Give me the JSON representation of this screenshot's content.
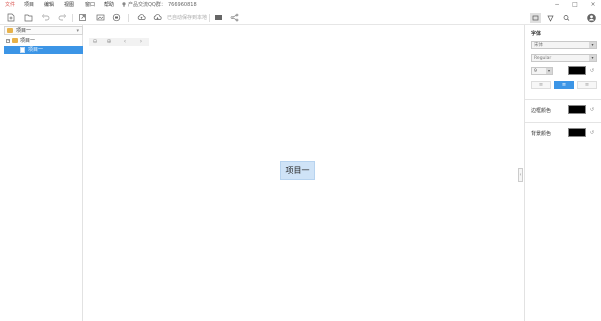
{
  "menubar": {
    "items": [
      {
        "label": "文件",
        "active": true
      },
      {
        "label": "项目"
      },
      {
        "label": "编辑"
      },
      {
        "label": "视图"
      },
      {
        "label": "窗口"
      },
      {
        "label": "帮助"
      }
    ],
    "support_text": "产品交流QQ群：",
    "qq_number": "766960818"
  },
  "toolbar": {
    "hint": "已自动保存到本地",
    "icons": [
      "new-file-icon",
      "open-folder-icon",
      "undo-icon",
      "redo-icon",
      "export-icon",
      "image-icon",
      "print-icon",
      "cloud-upload-icon",
      "cloud-download-icon",
      "screen-icon",
      "share-icon"
    ]
  },
  "right_toolbar": {
    "icons": [
      "style-panel-icon",
      "tag-icon",
      "search-icon",
      "user-avatar-icon"
    ]
  },
  "sidebar": {
    "header_title": "项目一",
    "tree": [
      {
        "label": "项目一",
        "toggle": "−"
      },
      {
        "label": "项目一",
        "selected": true
      }
    ]
  },
  "canvas": {
    "node_label": "项目一"
  },
  "style_panel": {
    "font_title": "字体",
    "font_family": "宋体",
    "font_weight": "Regular",
    "font_size": "9",
    "text_color": "#000000",
    "border_color_label": "边框颜色",
    "bg_color_label": "背景颜色",
    "border_color": "#000000",
    "bg_color": "#000000",
    "align": [
      "≡",
      "≡",
      "≡"
    ],
    "selected_align": 1
  },
  "colors": {
    "accent": "#3c95e6",
    "node_fill": "#cfe3f7",
    "menu_active": "#d9534f"
  }
}
